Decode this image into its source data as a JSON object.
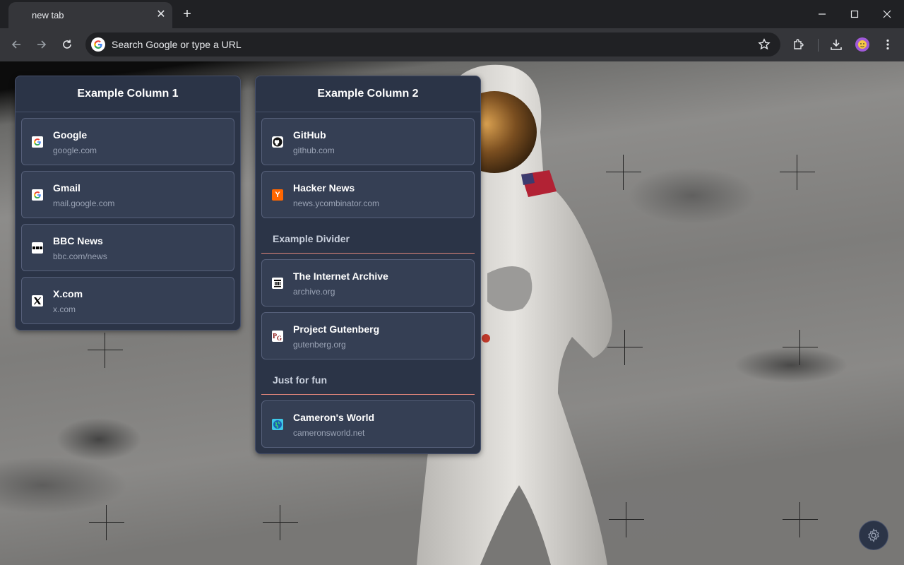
{
  "browser": {
    "tab": {
      "title": "new tab",
      "close": "✕"
    },
    "new_tab": "+",
    "omnibox": {
      "placeholder": "Search Google or type a URL"
    },
    "icons": [
      "back-icon",
      "forward-icon",
      "reload-icon",
      "google-icon",
      "star-icon",
      "extensions-icon",
      "download-icon",
      "avatar",
      "menu-icon",
      "minimize-icon",
      "maximize-icon",
      "close-window-icon"
    ]
  },
  "columns": [
    {
      "title": "Example Column 1",
      "items": [
        {
          "type": "link",
          "title": "Google",
          "url": "google.com",
          "icon": "google-icon"
        },
        {
          "type": "link",
          "title": "Gmail",
          "url": "mail.google.com",
          "icon": "google-icon"
        },
        {
          "type": "link",
          "title": "BBC News",
          "url": "bbc.com/news",
          "icon": "bbc-icon"
        },
        {
          "type": "link",
          "title": "X.com",
          "url": "x.com",
          "icon": "x-icon"
        }
      ]
    },
    {
      "title": "Example Column 2",
      "items": [
        {
          "type": "link",
          "title": "GitHub",
          "url": "github.com",
          "icon": "github-icon"
        },
        {
          "type": "link",
          "title": "Hacker News",
          "url": "news.ycombinator.com",
          "icon": "hackernews-icon"
        },
        {
          "type": "divider",
          "label": "Example Divider"
        },
        {
          "type": "link",
          "title": "The Internet Archive",
          "url": "archive.org",
          "icon": "archive-icon"
        },
        {
          "type": "link",
          "title": "Project Gutenberg",
          "url": "gutenberg.org",
          "icon": "gutenberg-icon"
        },
        {
          "type": "divider",
          "label": "Just for fun"
        },
        {
          "type": "link",
          "title": "Cameron's World",
          "url": "cameronsworld.net",
          "icon": "globe-icon"
        }
      ]
    }
  ],
  "colors": {
    "panel": "#2b3447",
    "card": "#353f54",
    "divider_line": "#e0857a",
    "hn_orange": "#ff6600"
  },
  "settings_button": {
    "icon": "gear-icon"
  }
}
